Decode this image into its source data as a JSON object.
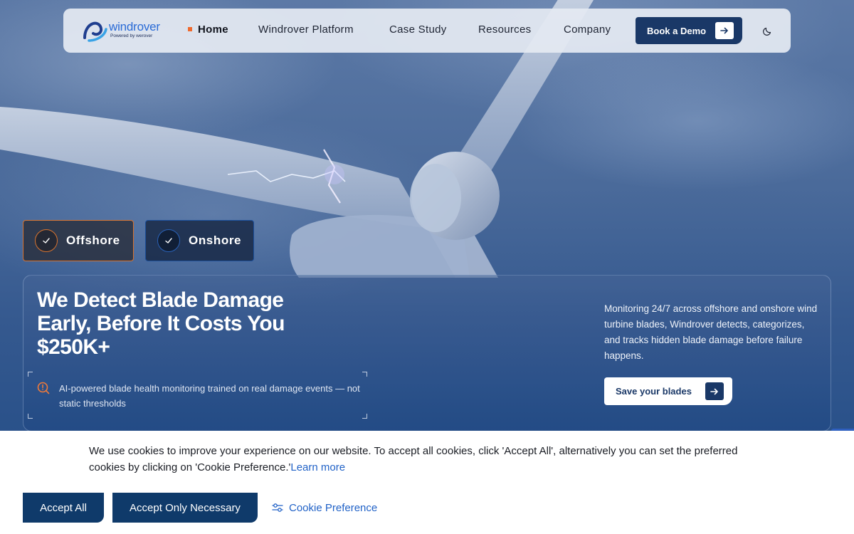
{
  "colors": {
    "brand_navy": "#1a3867",
    "accent_orange": "#ef6a2e",
    "link_blue": "#2162c7",
    "cookie_button": "#0f3a6a"
  },
  "nav": {
    "logo": {
      "name": "windrover",
      "tagline": "Powered by werover"
    },
    "items": [
      {
        "label": "Home",
        "active": true
      },
      {
        "label": "Windrover Platform"
      },
      {
        "label": "Case Study"
      },
      {
        "label": "Resources"
      },
      {
        "label": "Company"
      }
    ],
    "cta_label": "Book a Demo",
    "cta_icon": "arrow-right-icon",
    "theme_icon": "moon-icon"
  },
  "toggles": [
    {
      "label": "Offshore",
      "icon": "check-icon",
      "checked": true
    },
    {
      "label": "Onshore",
      "icon": "check-icon",
      "checked": true
    }
  ],
  "hero": {
    "title": "We Detect Blade Damage Early, Before It Costs You $250K+",
    "feature_icon": "alert-search-icon",
    "feature_text": "AI-powered blade health monitoring trained on real damage events — not static thresholds",
    "description": "Monitoring 24/7 across offshore and onshore wind turbine blades, Windrover detects, categorizes, and tracks hidden blade damage before failure happens.",
    "cta_label": "Save your blades",
    "cta_icon": "arrow-right-icon"
  },
  "cookie": {
    "text": "We use cookies to improve your experience on our website. To accept all cookies, click 'Accept All', alternatively you can set the preferred cookies by clicking on 'Cookie Preference.'",
    "link_label": "Learn more",
    "accept_all": "Accept All",
    "accept_necessary": "Accept Only Necessary",
    "preference": "Cookie Preference",
    "preference_icon": "sliders-icon"
  }
}
